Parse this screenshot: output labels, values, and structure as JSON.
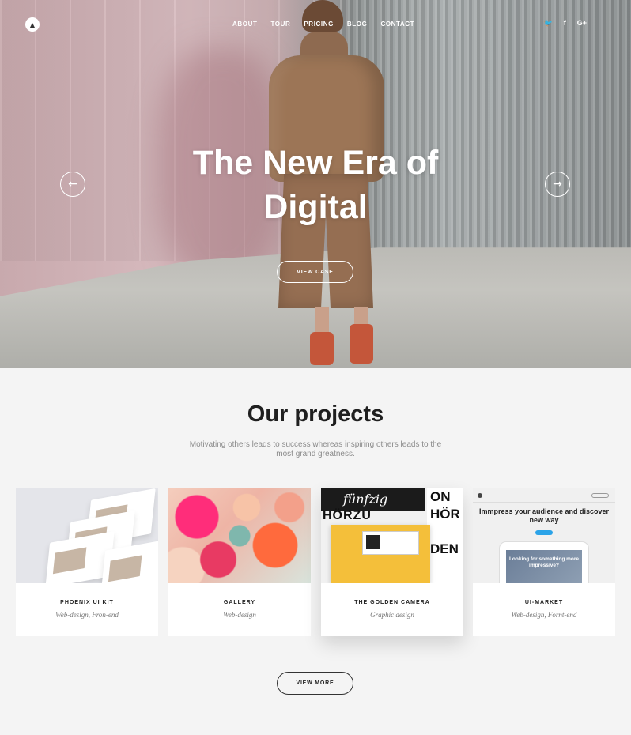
{
  "nav": {
    "logo_glyph": "▲",
    "menu": [
      "ABOUT",
      "TOUR",
      "PRICING",
      "BLOG",
      "CONTACT"
    ],
    "social": [
      {
        "icon": "twitter-icon",
        "glyph": "🐦"
      },
      {
        "icon": "facebook-icon",
        "glyph": "f"
      },
      {
        "icon": "google-plus-icon",
        "glyph": "G+"
      }
    ]
  },
  "hero": {
    "title_line1": "The New Era of",
    "title_line2": "Digital",
    "cta": "VIEW CASE",
    "prev_arrow": "←",
    "next_arrow": "→"
  },
  "projects": {
    "title": "Our projects",
    "subtitle": "Motivating others leads to success whereas inspiring others leads to the most grand greatness.",
    "cards": [
      {
        "title": "PHOENIX UI KIT",
        "tag": "Web-design, Fron-end"
      },
      {
        "title": "GALLERY",
        "tag": "Web-design"
      },
      {
        "title": "THE GOLDEN CAMERA",
        "tag": "Graphic design"
      },
      {
        "title": "UI-MARKET",
        "tag": "Web-design, Fornt-end"
      }
    ],
    "card3_thumb": {
      "script": "fünfzig",
      "hor": "HÖRZU",
      "right": "ON\nHÖR\n\nDEN"
    },
    "card4_thumb": {
      "headline": "Immpress your audience and discover new way",
      "screen_text": "Looking for something more impressive?"
    },
    "view_more": "VIEW MORE"
  }
}
